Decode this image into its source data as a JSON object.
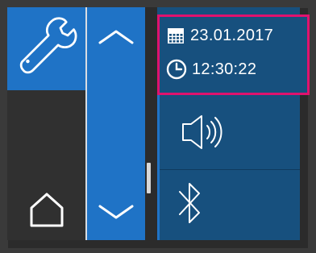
{
  "header": {
    "date": "23.01.2017",
    "time": "12:30:22"
  },
  "icons": {
    "settings": "wrench-icon",
    "home": "home-icon",
    "scroll_up": "chevron-up-icon",
    "scroll_down": "chevron-down-icon",
    "calendar": "calendar-icon",
    "clock": "clock-icon",
    "sound": "speaker-icon",
    "bluetooth": "bluetooth-icon"
  },
  "colors": {
    "accent_blue": "#1f73c6",
    "panel_dark_blue": "#17507e",
    "highlight_pink": "#e0126e",
    "background_dark": "#2b2b2b"
  },
  "scrollbar": {
    "position_fraction": 0.66
  }
}
